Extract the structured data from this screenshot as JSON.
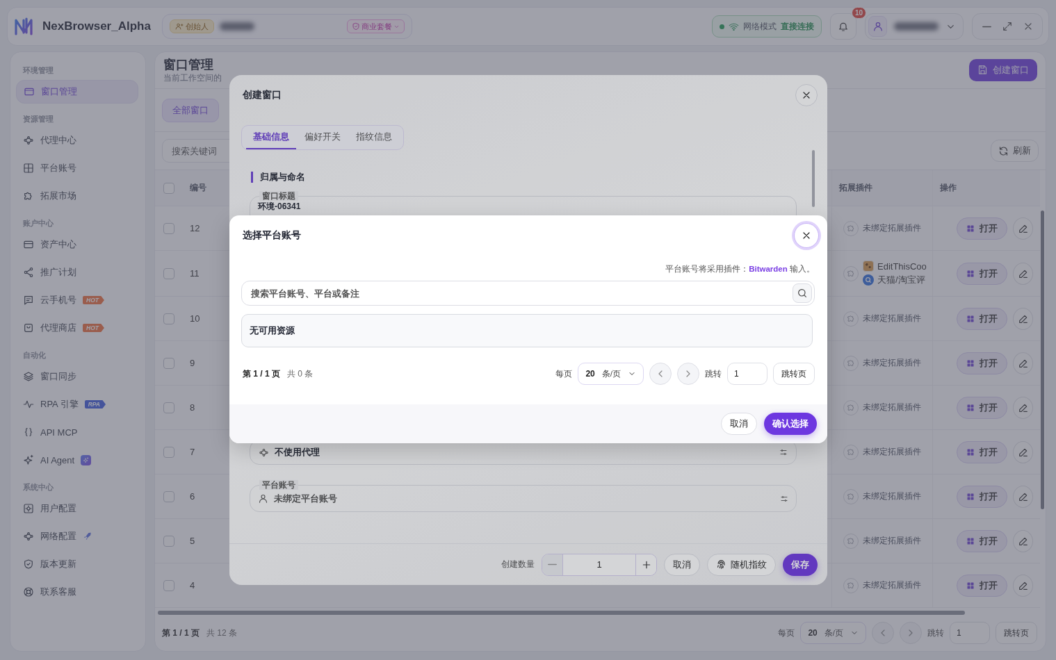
{
  "app": {
    "title": "NexBrowser_Alpha"
  },
  "workspace": {
    "role": "创始人",
    "plan": "商业套餐"
  },
  "network": {
    "label": "网络模式",
    "value": "直接连接"
  },
  "notifications": {
    "count": "10"
  },
  "sidebar": {
    "sections": [
      {
        "title": "环境管理",
        "items": [
          {
            "label": "窗口管理",
            "selected": true
          }
        ]
      },
      {
        "title": "资源管理",
        "items": [
          {
            "label": "代理中心",
            "selected": false
          },
          {
            "label": "平台账号",
            "selected": false
          },
          {
            "label": "拓展市场",
            "selected": false
          }
        ]
      },
      {
        "title": "账户中心",
        "items": [
          {
            "label": "资产中心",
            "selected": false
          },
          {
            "label": "推广计划",
            "selected": false
          },
          {
            "label": "云手机号",
            "selected": false,
            "badge": {
              "kind": "hot",
              "text": "HOT"
            }
          },
          {
            "label": "代理商店",
            "selected": false,
            "badge": {
              "kind": "hot",
              "text": "HOT"
            }
          }
        ]
      },
      {
        "title": "自动化",
        "items": [
          {
            "label": "窗口同步",
            "selected": false
          },
          {
            "label": "RPA 引擎",
            "selected": false,
            "badge": {
              "kind": "rpa",
              "text": "RPA"
            }
          },
          {
            "label": "API MCP",
            "selected": false
          },
          {
            "label": "AI Agent",
            "selected": false,
            "badge": {
              "kind": "ai"
            }
          }
        ]
      },
      {
        "title": "系统中心",
        "items": [
          {
            "label": "用户配置",
            "selected": false
          },
          {
            "label": "网络配置",
            "selected": false,
            "badge": {
              "kind": "rocket"
            }
          },
          {
            "label": "版本更新",
            "selected": false
          },
          {
            "label": "联系客服",
            "selected": false
          }
        ]
      }
    ]
  },
  "page": {
    "title": "窗口管理",
    "subtitle": "当前工作空间的",
    "create_button": "创建窗口"
  },
  "filter_tabs": [
    {
      "label": "全部窗口",
      "selected": true
    }
  ],
  "search": {
    "placeholder": "搜索关键词"
  },
  "refresh_button": "刷新",
  "table": {
    "select_all": {
      "checked": false
    },
    "columns": [
      {
        "label": "编号"
      },
      {
        "label": "拓展插件"
      },
      {
        "label": "操作"
      }
    ],
    "rows": [
      {
        "number": "12",
        "checked": false,
        "plugin_status": "未绑定拓展插件",
        "open": "打开"
      },
      {
        "number": "11",
        "checked": false,
        "plugins": [
          {
            "name": "EditThisCoo"
          },
          {
            "name": "天猫/淘宝评"
          }
        ],
        "open": "打开"
      },
      {
        "number": "10",
        "checked": false,
        "plugin_status": "未绑定拓展插件",
        "open": "打开"
      },
      {
        "number": "9",
        "checked": false,
        "plugin_status": "未绑定拓展插件",
        "open": "打开"
      },
      {
        "number": "8",
        "checked": false,
        "plugin_status": "未绑定拓展插件",
        "open": "打开"
      },
      {
        "number": "7",
        "checked": false,
        "plugin_status": "未绑定拓展插件",
        "open": "打开"
      },
      {
        "number": "6",
        "checked": false,
        "plugin_status": "未绑定拓展插件",
        "open": "打开"
      },
      {
        "number": "5",
        "checked": false,
        "plugin_status": "未绑定拓展插件",
        "open": "打开"
      },
      {
        "number": "4",
        "checked": false,
        "plugin_status": "未绑定拓展插件",
        "open": "打开"
      }
    ]
  },
  "pagination": {
    "page": "第 1 / 1 页",
    "total": "共 12 条",
    "per_page_label": "每页",
    "per_page": "20",
    "unit": "条/页",
    "jump_label": "跳转",
    "jump_value": "1",
    "jump_button": "跳转页"
  },
  "create_dialog": {
    "title": "创建窗口",
    "tabs": [
      {
        "label": "基础信息",
        "selected": true
      },
      {
        "label": "偏好开关",
        "selected": false
      },
      {
        "label": "指纹信息",
        "selected": false
      }
    ],
    "section": "归属与命名",
    "title_field": {
      "label": "窗口标题",
      "value": "环境-06341"
    },
    "proxy_field": {
      "value": "不使用代理"
    },
    "account_field": {
      "label": "平台账号",
      "value": "未绑定平台账号"
    },
    "footer": {
      "quantity_label": "创建数量",
      "quantity": "1",
      "cancel": "取消",
      "random": "随机指纹",
      "save": "保存"
    }
  },
  "account_dialog": {
    "title": "选择平台账号",
    "note": "平台账号将采用插件：**Bitwarden** 输入。",
    "search": {
      "placeholder": "搜索平台账号、平台或备注"
    },
    "empty": "无可用资源",
    "pagination": {
      "page": "第 1 / 1 页",
      "total": "共 0 条",
      "per_page_label": "每页",
      "per_page": "20",
      "unit": "条/页",
      "jump_label": "跳转",
      "jump_value": "1",
      "jump_button": "跳转页"
    },
    "cancel": "取消",
    "confirm": "确认选择"
  }
}
